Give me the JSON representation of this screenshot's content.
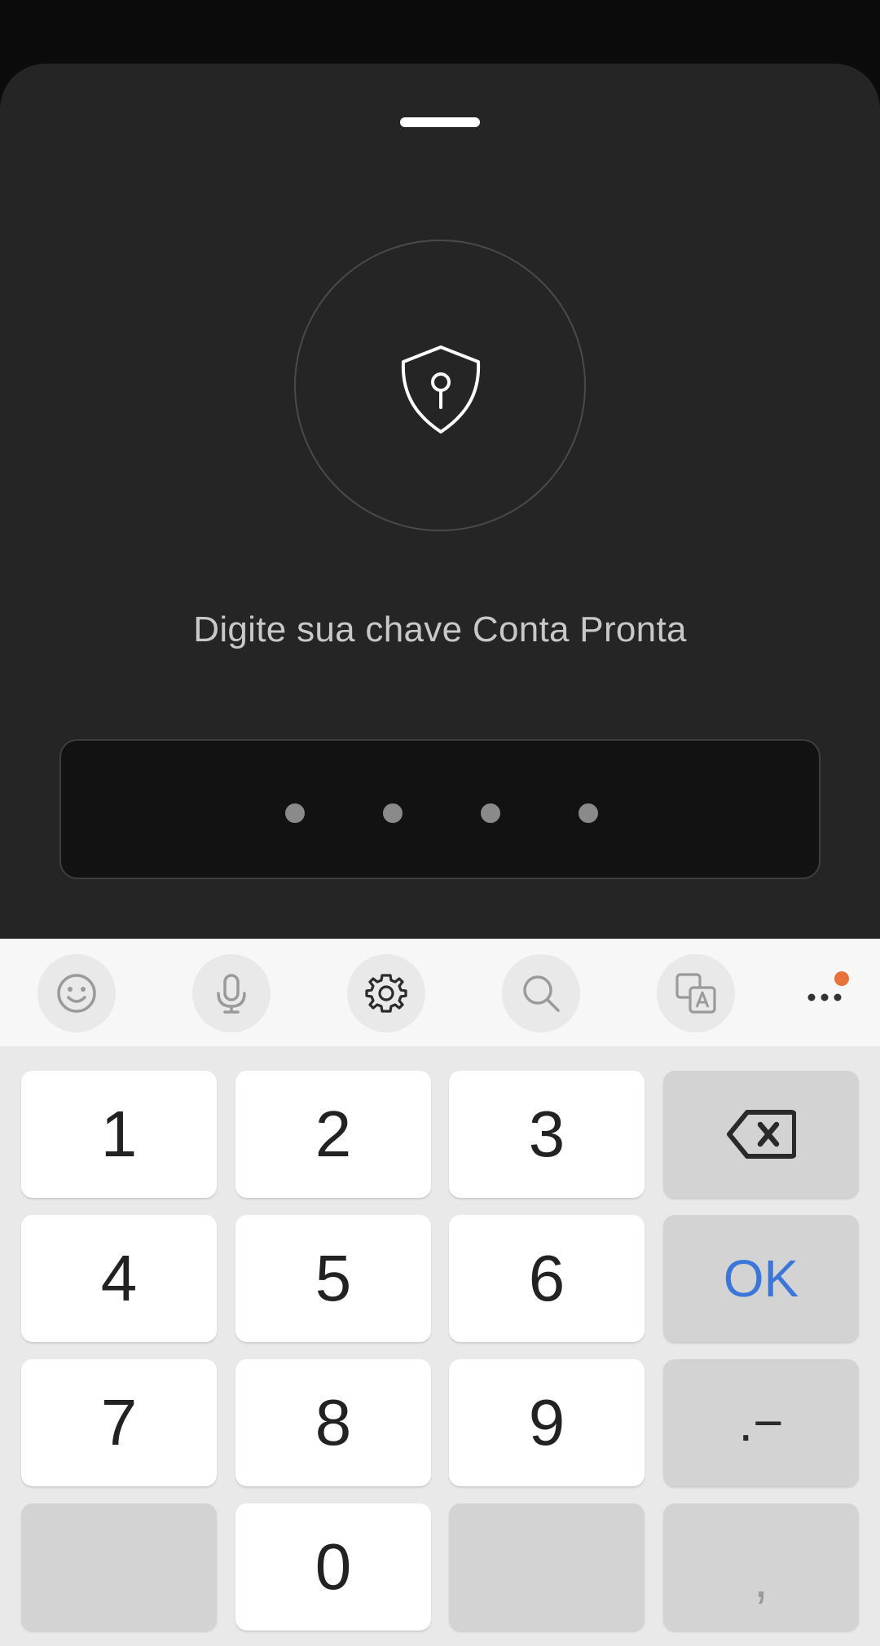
{
  "auth": {
    "prompt": "Digite sua chave Conta Pronta",
    "pin_length": 4,
    "icon": "shield-lock-icon"
  },
  "toolbar": {
    "buttons": [
      "emoji-icon",
      "microphone-icon",
      "settings-icon",
      "search-icon",
      "translate-icon",
      "more-icon"
    ],
    "notification_color": "#e8733a"
  },
  "keypad": {
    "k1": "1",
    "k2": "2",
    "k3": "3",
    "k4": "4",
    "k5": "5",
    "k6": "6",
    "k7": "7",
    "k8": "8",
    "k9": "9",
    "k0": "0",
    "ok": "OK",
    "punct": ".−",
    "comma": ","
  },
  "colors": {
    "sheet_bg": "#252526",
    "ok_accent": "#3b76d8"
  }
}
